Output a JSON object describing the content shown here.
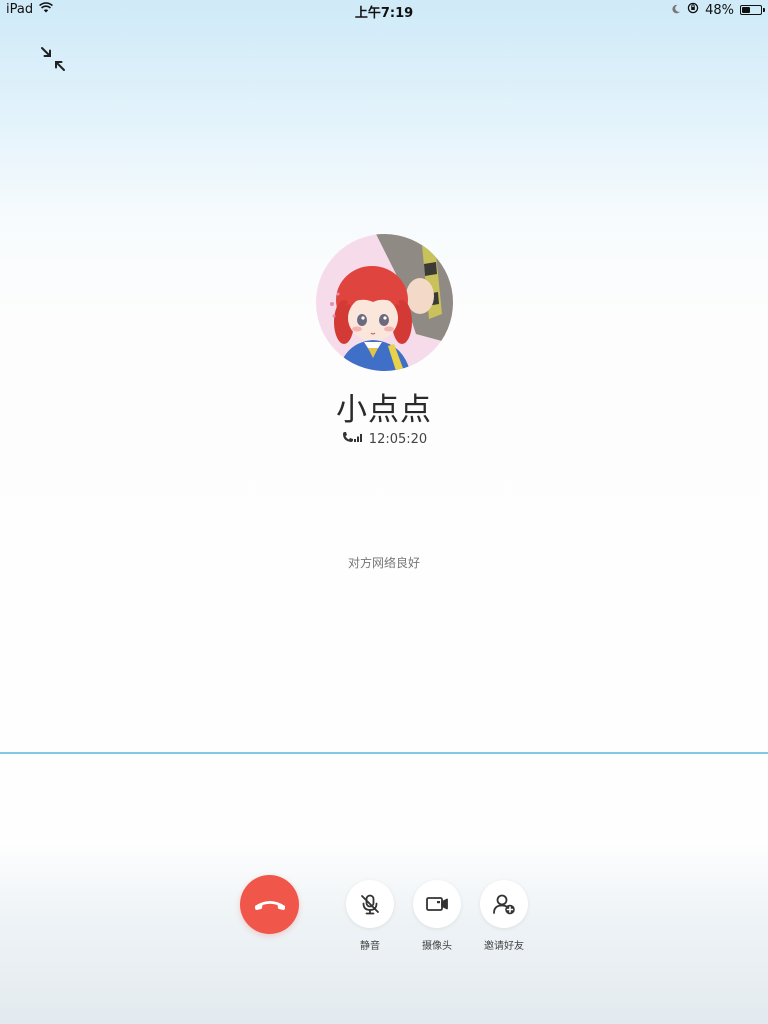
{
  "status_bar": {
    "device": "iPad",
    "time": "上午7:19",
    "battery_percent": "48%",
    "battery_level": 0.48
  },
  "window": {
    "minimize_icon": "minimize-arrows-icon"
  },
  "call": {
    "caller_name": "小点点",
    "duration": "12:05:20",
    "network_status": "对方网络良好"
  },
  "controls": {
    "hangup_icon": "hangup-icon",
    "mute_label": "静音",
    "camera_label": "摄像头",
    "invite_label": "邀请好友"
  },
  "colors": {
    "hangup": "#f0574a",
    "divider": "#7ecbe3"
  }
}
